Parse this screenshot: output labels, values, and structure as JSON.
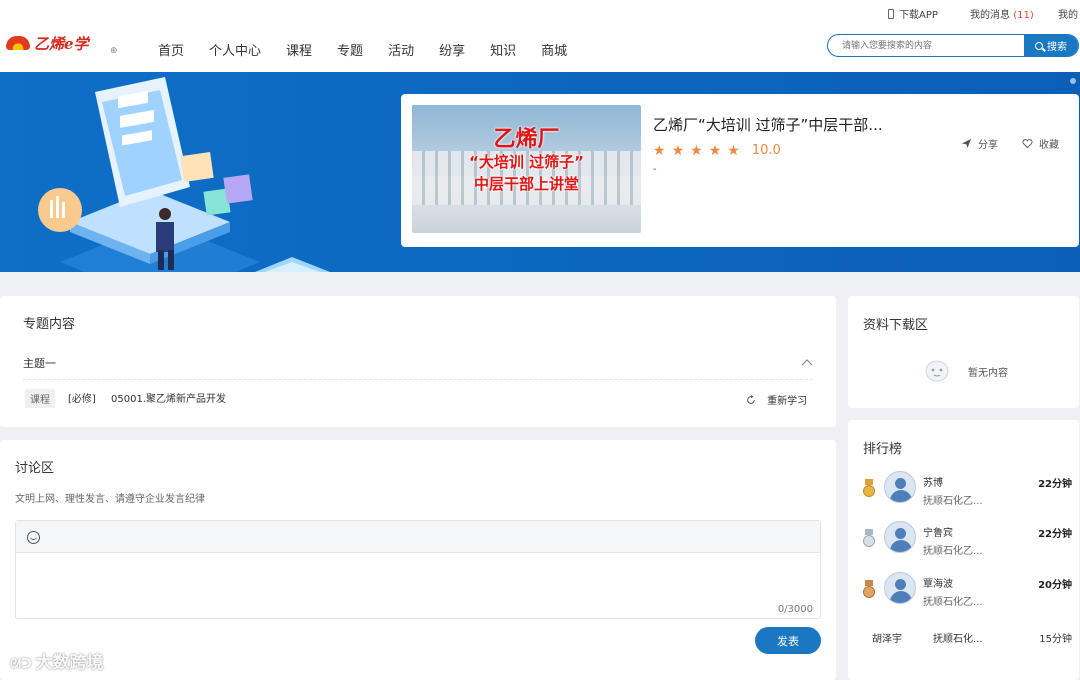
{
  "topbar": {
    "download_app": "下载APP",
    "my_messages": "我的消息",
    "message_count": "(11)",
    "my": "我的"
  },
  "header": {
    "logo_text": "乙烯e学",
    "nav": [
      "首页",
      "个人中心",
      "课程",
      "专题",
      "活动",
      "纷享",
      "知识",
      "商城"
    ],
    "search_placeholder": "请输入您要搜索的内容",
    "search_button": "搜索"
  },
  "banner": {
    "thumbnail_lines": [
      "乙烯厂",
      "“大培训 过筛子”",
      "中层干部上讲堂"
    ],
    "title": "乙烯厂“大培训 过筛子”中层干部...",
    "rating_stars": 5,
    "score": "10.0",
    "description": "-",
    "share_label": "分享",
    "favorite_label": "收藏"
  },
  "topic_content": {
    "title": "专题内容",
    "section_title": "主题一",
    "items": [
      {
        "tag": "课程",
        "required": "[必修]",
        "name": "05001.聚乙烯新产品开发",
        "action": "重新学习"
      }
    ]
  },
  "discussion": {
    "title": "讨论区",
    "notice": "文明上网、理性发言、请遵守企业发言纪律",
    "counter": "0/3000",
    "post_button": "发表"
  },
  "downloads": {
    "title": "资料下载区",
    "empty_text": "暂无内容"
  },
  "ranking": {
    "title": "排行榜",
    "entries": [
      {
        "name": "苏博",
        "org": "抚顺石化乙...",
        "minutes": "22分钟",
        "medal": "gold"
      },
      {
        "name": "宁鲁宾",
        "org": "抚顺石化乙...",
        "minutes": "22分钟",
        "medal": "silver"
      },
      {
        "name": "覃海波",
        "org": "抚顺石化乙...",
        "minutes": "20分钟",
        "medal": "bronze"
      },
      {
        "name": "胡泽宇",
        "org": "抚顺石化...",
        "minutes": "15分钟",
        "medal": ""
      }
    ]
  },
  "watermark": "大数跨境",
  "colors": {
    "brand_blue": "#1a78c2",
    "banner_blue": "#0e6fc7",
    "star_orange": "#f08a3c",
    "logo_red": "#d42b1e"
  }
}
